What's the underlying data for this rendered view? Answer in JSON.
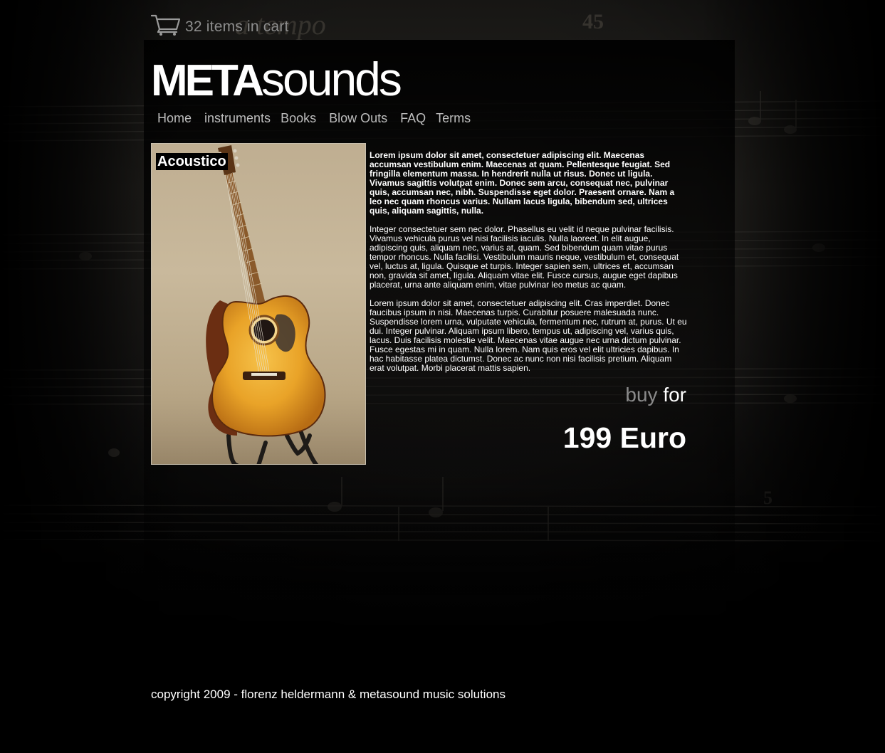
{
  "cart": {
    "text": "32 items in cart",
    "icon": "shopping-cart-icon"
  },
  "brand": {
    "bold": "META",
    "light": "sounds"
  },
  "nav": {
    "items": [
      {
        "label": "Home"
      },
      {
        "label": "instruments"
      },
      {
        "label": "Books"
      },
      {
        "label": "Blow Outs"
      },
      {
        "label": "FAQ"
      },
      {
        "label": "Terms"
      }
    ]
  },
  "product": {
    "title": "Acoustico",
    "image_icon": "acoustic-guitar-image",
    "paragraphs": [
      "Lorem ipsum dolor sit amet, consectetuer adipiscing elit. Maecenas accumsan vestibulum enim. Maecenas at quam. Pellentesque feugiat. Sed fringilla elementum massa. In hendrerit nulla ut risus. Donec ut ligula. Vivamus sagittis volutpat enim. Donec sem arcu, consequat nec, pulvinar quis, accumsan nec, nibh. Suspendisse eget dolor. Praesent ornare. Nam a leo nec quam rhoncus varius. Nullam lacus ligula, bibendum sed, ultrices quis, aliquam sagittis, nulla.",
      "Integer consectetuer sem nec dolor. Phasellus eu velit id neque pulvinar facilisis. Vivamus vehicula purus vel nisi facilisis iaculis. Nulla laoreet. In elit augue, adipiscing quis, aliquam nec, varius at, quam. Sed bibendum quam vitae purus tempor rhoncus. Nulla facilisi. Vestibulum mauris neque, vestibulum et, consequat vel, luctus at, ligula. Quisque et turpis. Integer sapien sem, ultrices et, accumsan non, gravida sit amet, ligula. Aliquam vitae elit. Fusce cursus, augue eget dapibus placerat, urna ante aliquam enim, vitae pulvinar leo metus ac quam.",
      "Lorem ipsum dolor sit amet, consectetuer adipiscing elit. Cras imperdiet. Donec faucibus ipsum in nisi. Maecenas turpis. Curabitur posuere malesuada nunc. Suspendisse lorem urna, vulputate vehicula, fermentum nec, rutrum at, purus. Ut eu dui. Integer pulvinar. Aliquam ipsum libero, tempus ut, adipiscing vel, varius quis, lacus. Duis facilisis molestie velit. Maecenas vitae augue nec urna dictum pulvinar. Fusce egestas mi in quam. Nulla lorem. Nam quis eros vel elit ultricies dapibus. In hac habitasse platea dictumst. Donec ac nunc non nisi facilisis pretium. Aliquam erat volutpat. Morbi placerat mattis sapien."
    ],
    "buy": "buy",
    "for": "for",
    "price": "199 Euro"
  },
  "footer": {
    "text": "copyright 2009 - florenz heldermann & metasound music solutions"
  },
  "colors": {
    "background": "#000000",
    "text": "#ffffff",
    "muted": "#8d8d8d",
    "nav": "#bdbdbd"
  }
}
